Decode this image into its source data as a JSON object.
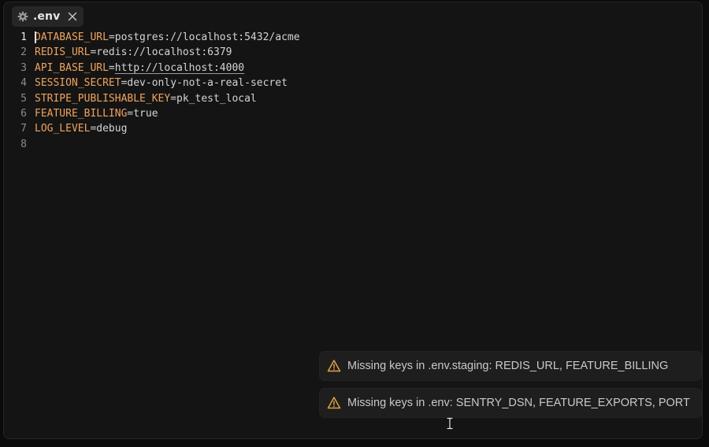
{
  "tab": {
    "icon": "gear-icon",
    "label": ".env",
    "close_icon": "close-icon"
  },
  "editor": {
    "active_line": 1,
    "lines": [
      {
        "number": "1",
        "key": "DATABASE_URL",
        "eq": "=",
        "value": "postgres://localhost:5432/acme",
        "is_link": false
      },
      {
        "number": "2",
        "key": "REDIS_URL",
        "eq": "=",
        "value": "redis://localhost:6379",
        "is_link": false
      },
      {
        "number": "3",
        "key": "API_BASE_URL",
        "eq": "=",
        "value": "http://localhost:4000",
        "is_link": true
      },
      {
        "number": "4",
        "key": "SESSION_SECRET",
        "eq": "=",
        "value": "dev-only-not-a-real-secret",
        "is_link": false
      },
      {
        "number": "5",
        "key": "STRIPE_PUBLISHABLE_KEY",
        "eq": "=",
        "value": "pk_test_local",
        "is_link": false
      },
      {
        "number": "6",
        "key": "FEATURE_BILLING",
        "eq": "=",
        "value": "true",
        "is_link": false
      },
      {
        "number": "7",
        "key": "LOG_LEVEL",
        "eq": "=",
        "value": "debug",
        "is_link": false
      },
      {
        "number": "8",
        "key": "",
        "eq": "",
        "value": "",
        "is_link": false
      }
    ]
  },
  "notifications": [
    {
      "icon": "warning-icon",
      "text": "Missing keys in .env.staging: REDIS_URL, FEATURE_BILLING"
    },
    {
      "icon": "warning-icon",
      "text": "Missing keys in .env: SENTRY_DSN, FEATURE_EXPORTS, PORT"
    }
  ],
  "colors": {
    "background": "#141414",
    "key": "#f0a35e",
    "value": "#d4d4d4",
    "warning": "#e0a243",
    "toast_bg": "#1e1e1e"
  }
}
